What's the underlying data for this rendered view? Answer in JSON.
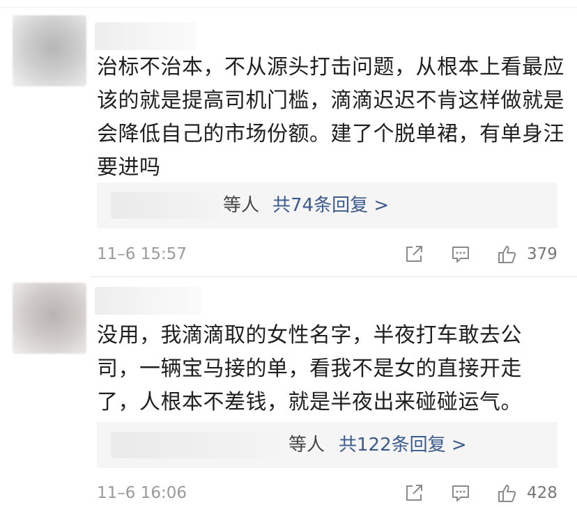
{
  "comments": [
    {
      "text": "治标不治本，不从源头打击问题，从根本上看最应该的就是提高司机门槛，滴滴迟迟不肯这样做就是会降低自己的市场份额。建了个脱单裙，有单身汪要进吗",
      "replies_who": "等人",
      "replies_count": "共74条回复 >",
      "time": "11–6 15:57",
      "likes": "379"
    },
    {
      "text": "没用，我滴滴取的女性名字，半夜打车敢去公司，一辆宝马接的单，看我不是女的直接开走了，人根本不差钱，就是半夜出来碰碰运气。",
      "replies_who": "等人",
      "replies_count": "共122条回复 >",
      "time": "11–6 16:06",
      "likes": "428"
    }
  ],
  "icons": [
    "share-icon",
    "comment-icon",
    "like-icon"
  ],
  "colors": {
    "link": "#3b5b8f",
    "meta": "#9a9a9a",
    "reply_bg": "#f5f5f5"
  }
}
